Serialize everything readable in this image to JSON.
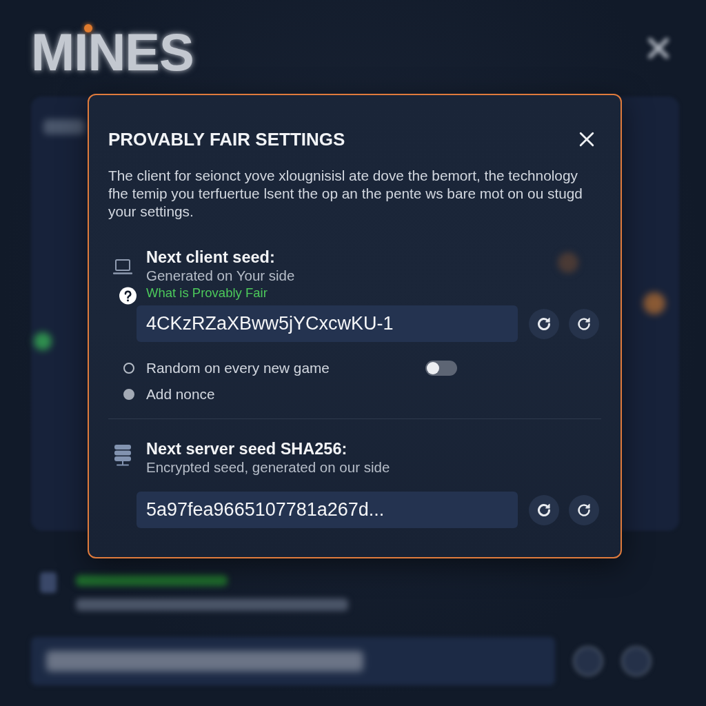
{
  "background": {
    "logo": "MINES"
  },
  "dialog": {
    "title": "PROVABLY FAIR SETTINGS",
    "description": "The client for seionct yove xlougnisisl ate dove the bemort, the technology fhe temip you terfuertue lsent the op an the pente ws bare mot on ou stugd your settings."
  },
  "client_seed": {
    "heading": "Next client seed:",
    "subtitle": "Generated on Your side",
    "help_link": "What is Provably Fair",
    "value": "4CKzRZaXBww5jYCxcwKU-1"
  },
  "options": [
    {
      "kind": "radio_switch",
      "label": "Random on every new game",
      "selected": false,
      "switch_on": false
    },
    {
      "kind": "radio",
      "label": "Add nonce",
      "selected": true
    }
  ],
  "server_seed": {
    "heading": "Next server seed SHA256:",
    "subtitle": "Encrypted seed, generated on our side",
    "value": "5a97fea9665107781a267d..."
  }
}
